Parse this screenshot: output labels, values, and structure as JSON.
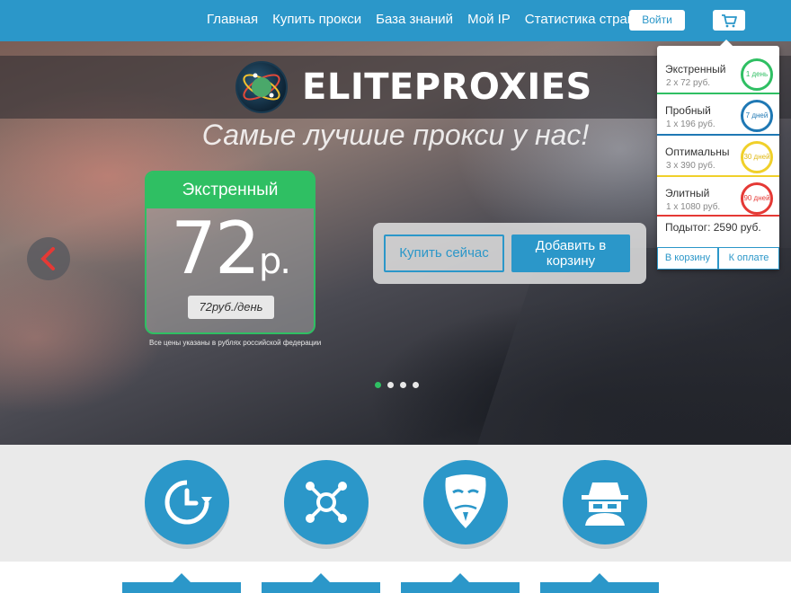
{
  "nav": {
    "items": [
      "Главная",
      "Купить прокси",
      "База знаний",
      "Мой IP",
      "Статистика стран"
    ],
    "login": "Войти",
    "cart_icon": "cart-icon"
  },
  "hero": {
    "brand": "ELITEPROXIES",
    "tagline": "Самые лучшие прокси у нас!",
    "plan": {
      "name": "Экстренный",
      "price": "72",
      "currency": "р.",
      "rate": "72руб./день",
      "note": "Все цены указаны в рублях российской федерации"
    },
    "buy_now": "Купить сейчас",
    "add_to_cart": "Добавить в корзину",
    "slides_total": 4,
    "slide_active": 1
  },
  "cart": {
    "items": [
      {
        "name": "Экстренный",
        "qty": "2 x 72 руб.",
        "badge": "1 день",
        "color": "#2fbf63"
      },
      {
        "name": "Пробный",
        "qty": "1 x 196 руб.",
        "badge": "7 дней",
        "color": "#1f78b4"
      },
      {
        "name": "Оптимальны",
        "qty": "3 x 390 руб.",
        "badge": "30 дней",
        "color": "#f0d02a"
      },
      {
        "name": "Элитный",
        "qty": "1 x 1080 руб.",
        "badge": "90 дней",
        "color": "#e53935"
      }
    ],
    "total": "Подытог: 2590 руб.",
    "to_cart": "В корзину",
    "checkout": "К оплате"
  },
  "features": [
    "clock-refresh-icon",
    "network-hub-icon",
    "anonymous-mask-icon",
    "spy-incognito-icon"
  ],
  "colors": {
    "brand_blue": "#2b97c9",
    "accent_green": "#2fbf63"
  }
}
